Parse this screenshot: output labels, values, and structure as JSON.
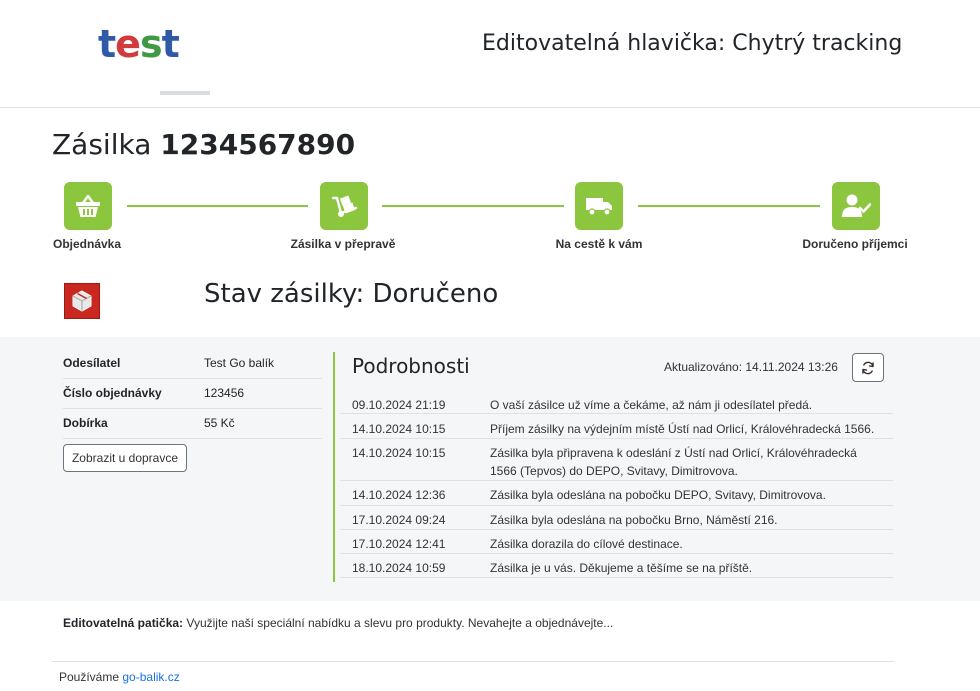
{
  "header": {
    "logo_text": [
      "t",
      "e",
      "s",
      "t"
    ],
    "title": "Editovatelná hlavička: Chytrý tracking"
  },
  "shipment": {
    "label": "Zásilka",
    "number": "1234567890"
  },
  "steps": [
    {
      "label": "Objednávka",
      "icon": "basket-icon"
    },
    {
      "label": "Zásilka v přepravě",
      "icon": "hand-truck-icon"
    },
    {
      "label": "Na cestě k vám",
      "icon": "truck-icon"
    },
    {
      "label": "Doručeno příjemci",
      "icon": "user-check-icon"
    }
  ],
  "status": {
    "title": "Stav zásilky: Doručeno",
    "icon": "package-icon",
    "icon_color": "#c9271f"
  },
  "info": [
    {
      "key": "Odesílatel",
      "value": "Test Go balík"
    },
    {
      "key": "Číslo objednávky",
      "value": "123456"
    },
    {
      "key": "Dobírka",
      "value": "55 Kč"
    }
  ],
  "carrier_button": "Zobrazit u dopravce",
  "details": {
    "title": "Podrobnosti",
    "updated": "Aktualizováno: 14.11.2024 13:26",
    "refresh_icon": "refresh-icon",
    "events": [
      {
        "date": "09.10.2024 21:19",
        "text": "O vaší zásilce už víme a čekáme, až nám ji odesílatel předá."
      },
      {
        "date": "14.10.2024 10:15",
        "text": "Příjem zásilky na výdejním místě Ústí nad Orlicí, Královéhradecká 1566."
      },
      {
        "date": "14.10.2024 10:15",
        "text": "Zásilka byla připravena k odeslání z Ústí nad Orlicí, Královéhradecká 1566 (Tepvos) do DEPO, Svitavy, Dimitrovova."
      },
      {
        "date": "14.10.2024 12:36",
        "text": "Zásilka byla odeslána na pobočku DEPO, Svitavy, Dimitrovova."
      },
      {
        "date": "17.10.2024 09:24",
        "text": "Zásilka byla odeslána na pobočku Brno, Náměstí 216."
      },
      {
        "date": "17.10.2024 12:41",
        "text": "Zásilka dorazila do cílové destinace."
      },
      {
        "date": "18.10.2024 10:59",
        "text": "Zásilka je u vás. Děkujeme a těšíme se na příště."
      }
    ]
  },
  "footer": {
    "note_label": "Editovatelná patička:",
    "note_text": " Využijte naší speciální nabídku a slevu pro produkty. Nevahejte a objednávejte...",
    "use_text": "Používáme ",
    "use_link": "go-balik.cz"
  },
  "colors": {
    "accent": "#8cc63f",
    "link": "#1a73e8",
    "panel_bg": "#f5f6f7"
  }
}
